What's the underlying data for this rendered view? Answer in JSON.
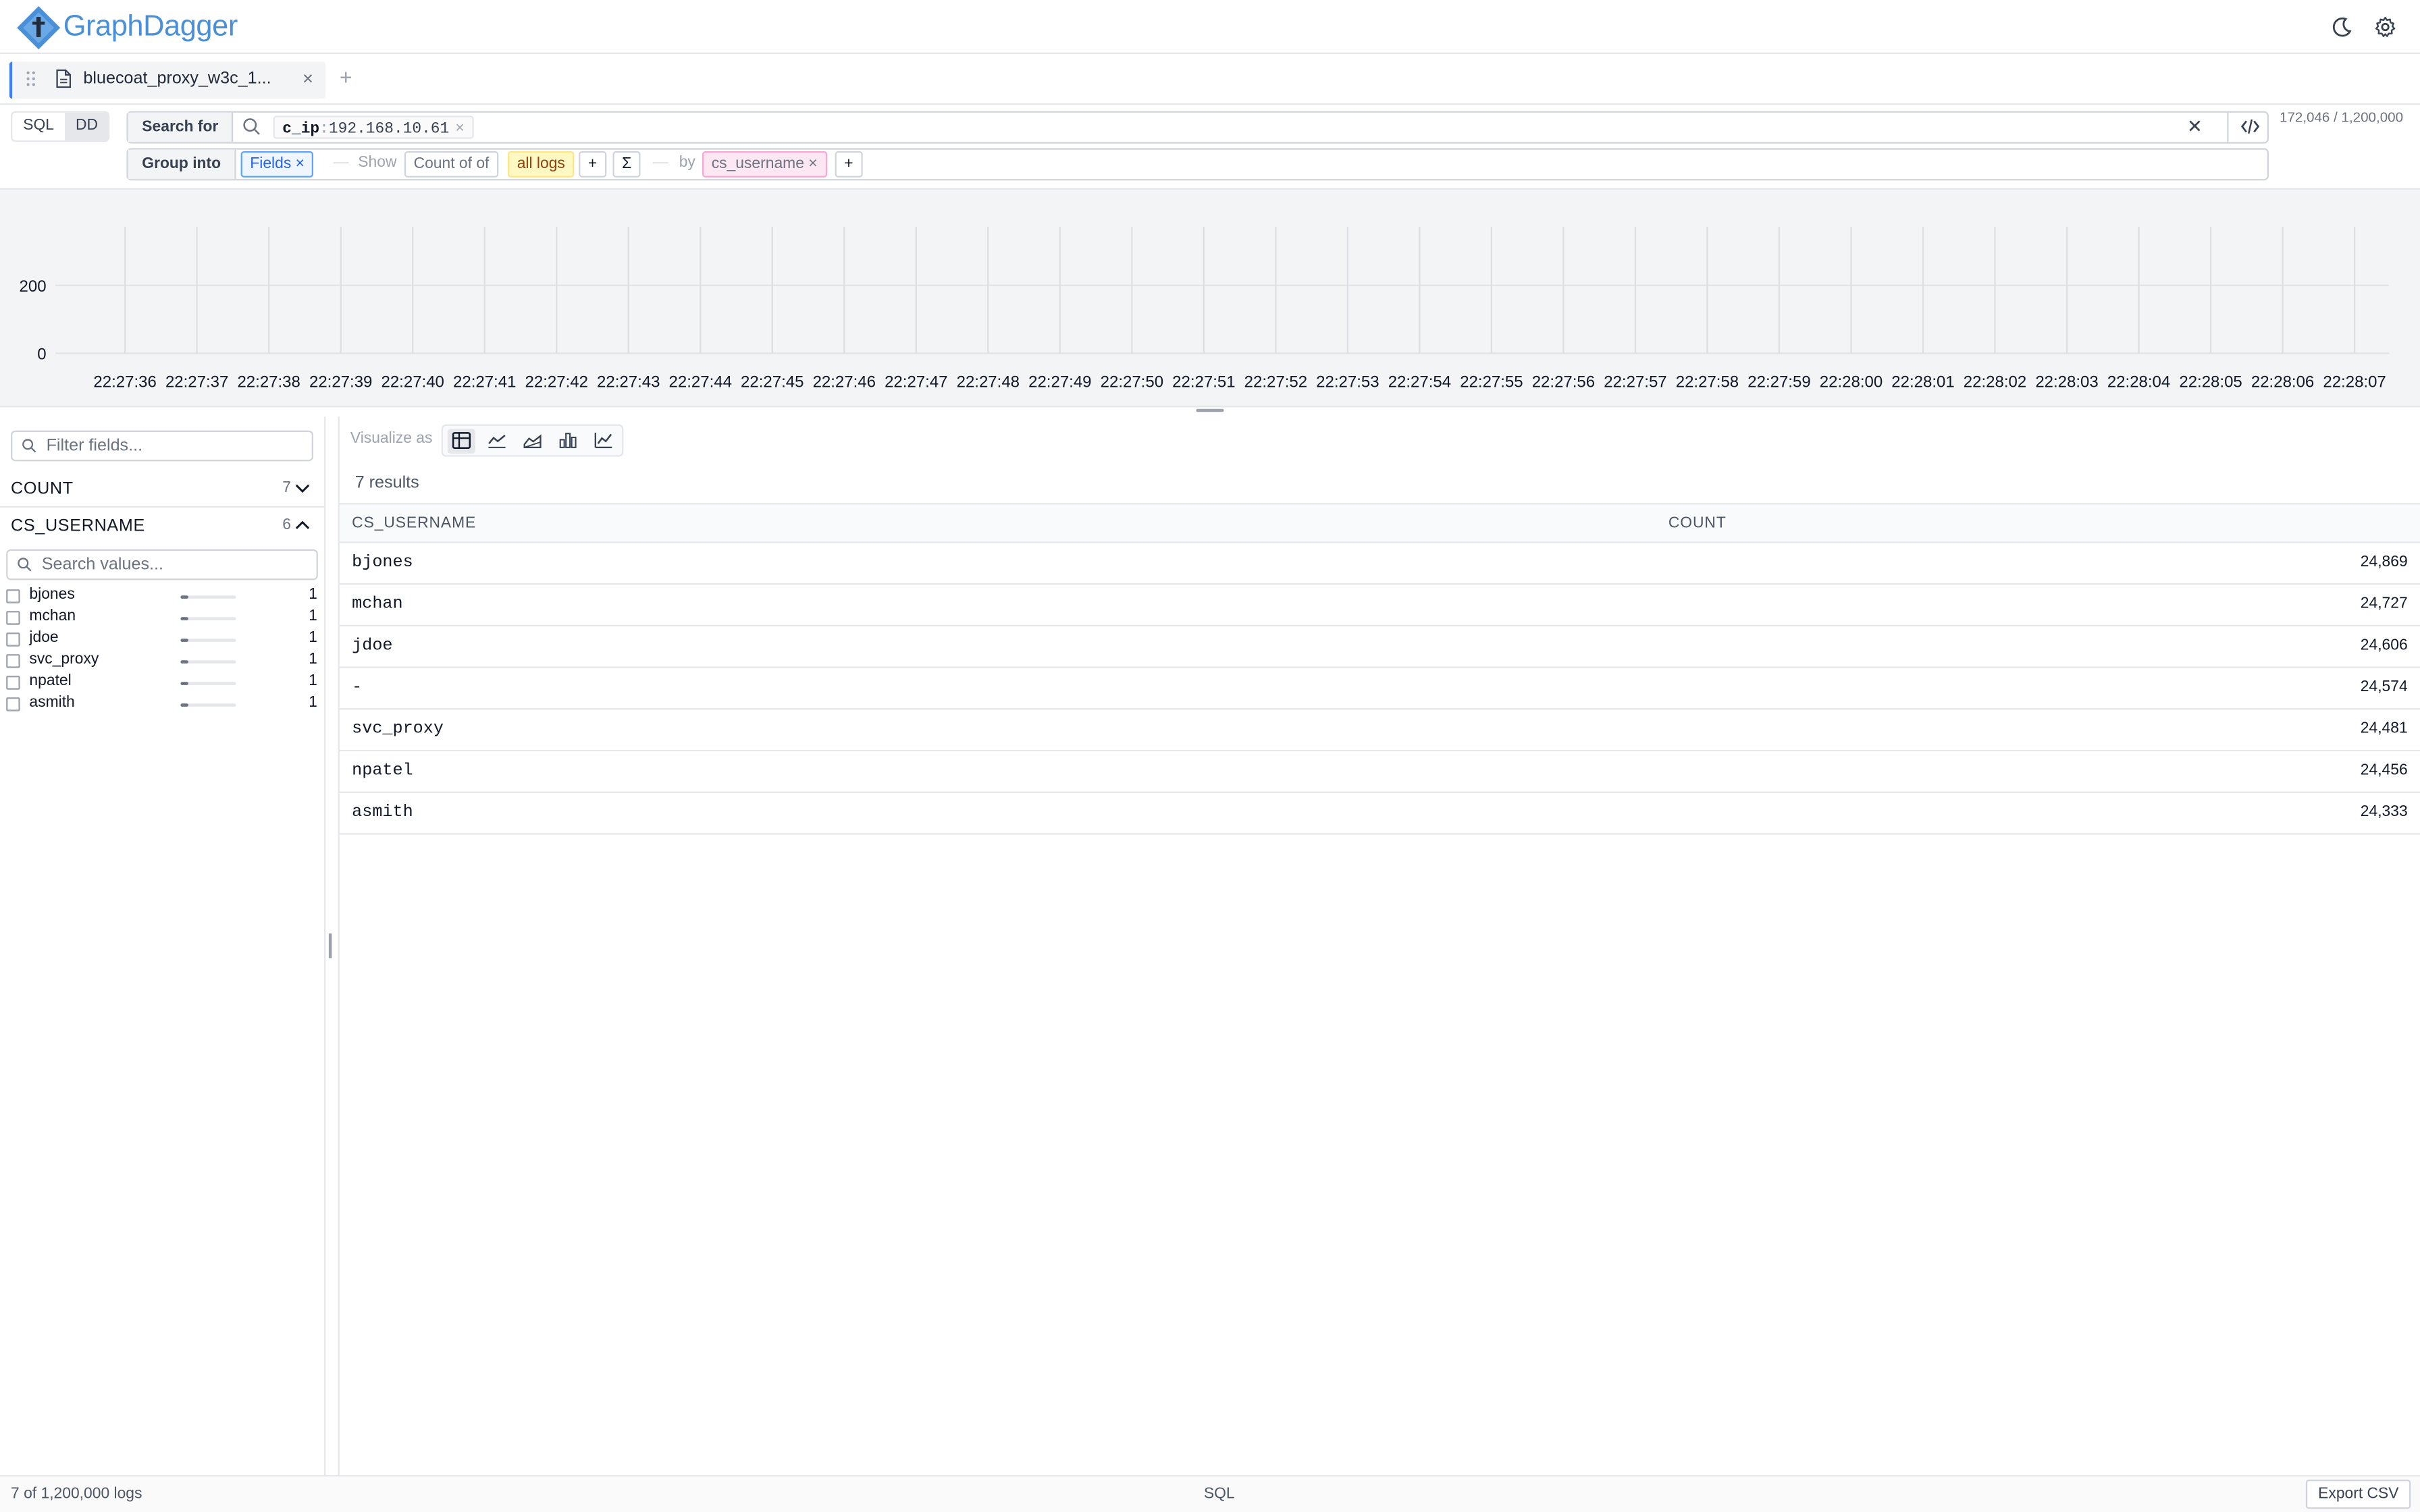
{
  "app": {
    "brand": "GraphDagger",
    "logo_icon": "dagger-logo-icon",
    "accent": "#4a90d9"
  },
  "header": {
    "icons": [
      "moon-icon",
      "gear-icon"
    ]
  },
  "tabs": [
    {
      "label": "bluecoat_proxy_w3c_1...",
      "active": true
    }
  ],
  "query": {
    "modes": [
      {
        "label": "SQL",
        "active": false
      },
      {
        "label": "DD",
        "active": true
      }
    ],
    "search_label": "Search for",
    "filter": {
      "field": "c_ip",
      "separator": ":",
      "value": "192.168.10.61"
    },
    "group_label": "Group into",
    "group_chip": "Fields",
    "show_text": "Show",
    "count_of": "Count of of",
    "all_logs": "all logs",
    "plus": "+",
    "sigma": "Σ",
    "by_text": "by",
    "by_field": "cs_username",
    "count_indicator": "172,046 / 1,200,000"
  },
  "timeline": {
    "y_ticks": [
      "200",
      "0"
    ],
    "x_ticks": [
      "22:27:36",
      "22:27:37",
      "22:27:38",
      "22:27:39",
      "22:27:40",
      "22:27:41",
      "22:27:42",
      "22:27:43",
      "22:27:44",
      "22:27:45",
      "22:27:46",
      "22:27:47",
      "22:27:48",
      "22:27:49",
      "22:27:50",
      "22:27:51",
      "22:27:52",
      "22:27:53",
      "22:27:54",
      "22:27:55",
      "22:27:56",
      "22:27:57",
      "22:27:58",
      "22:27:59",
      "22:28:00",
      "22:28:01",
      "22:28:02",
      "22:28:03",
      "22:28:04",
      "22:28:05",
      "22:28:06",
      "22:28:07"
    ]
  },
  "sidebar": {
    "filter_placeholder": "Filter fields...",
    "fields": [
      {
        "name": "COUNT",
        "count": "7",
        "expanded": false
      },
      {
        "name": "CS_USERNAME",
        "count": "6",
        "expanded": true
      }
    ],
    "values_placeholder": "Search values...",
    "values": [
      {
        "name": "bjones",
        "count": "1",
        "fraction": 0.14
      },
      {
        "name": "mchan",
        "count": "1",
        "fraction": 0.14
      },
      {
        "name": "jdoe",
        "count": "1",
        "fraction": 0.14
      },
      {
        "name": "svc_proxy",
        "count": "1",
        "fraction": 0.14
      },
      {
        "name": "npatel",
        "count": "1",
        "fraction": 0.14
      },
      {
        "name": "asmith",
        "count": "1",
        "fraction": 0.14
      }
    ]
  },
  "results": {
    "visualize_label": "Visualize as",
    "viz_icons": [
      "table-icon",
      "line-chart-icon",
      "area-chart-icon",
      "bar-chart-icon",
      "combo-chart-icon"
    ],
    "count_text": "7 results",
    "columns": [
      "CS_USERNAME",
      "COUNT"
    ],
    "rows": [
      {
        "user": "bjones",
        "count": "24,869"
      },
      {
        "user": "mchan",
        "count": "24,727"
      },
      {
        "user": "jdoe",
        "count": "24,606"
      },
      {
        "user": "-",
        "count": "24,574"
      },
      {
        "user": "svc_proxy",
        "count": "24,481"
      },
      {
        "user": "npatel",
        "count": "24,456"
      },
      {
        "user": "asmith",
        "count": "24,333"
      }
    ]
  },
  "footer": {
    "status": "7 of 1,200,000 logs",
    "center": "SQL",
    "export": "Export CSV"
  }
}
